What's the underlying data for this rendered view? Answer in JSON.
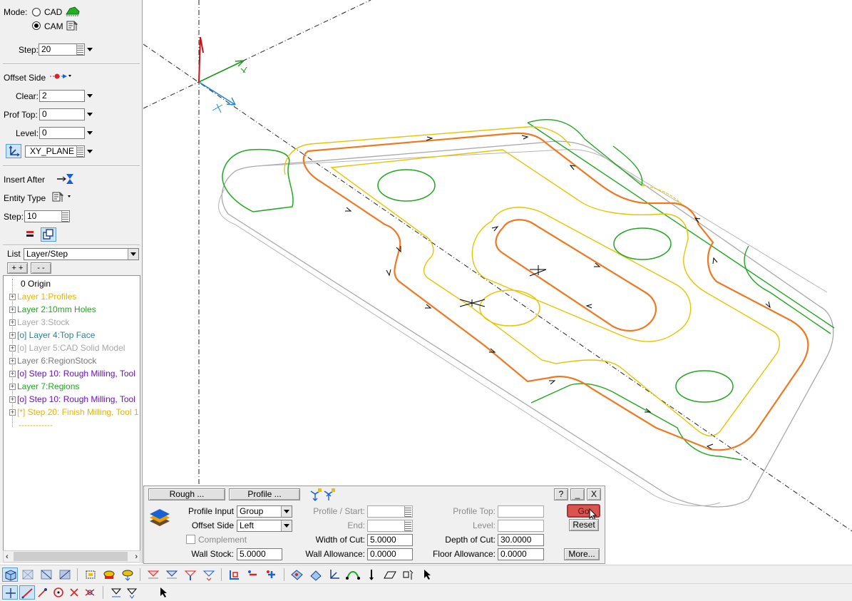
{
  "left_panel": {
    "mode_label": "Mode:",
    "mode_cad": "CAD",
    "mode_cam": "CAM",
    "step_label": "Step:",
    "step_value": "20",
    "offset_side_label": "Offset Side",
    "clear_label": "Clear:",
    "clear_value": "2",
    "prof_top_label": "Prof Top:",
    "prof_top_value": "0",
    "level_label": "Level:",
    "level_value": "0",
    "plane_value": "XY_PLANE",
    "insert_after_label": "Insert After",
    "entity_type_label": "Entity Type",
    "step2_label": "Step:",
    "step2_value": "10",
    "list_label": "List",
    "list_value": "Layer/Step",
    "expand_all": "+ +",
    "collapse_all": "- -"
  },
  "tree": {
    "items": [
      {
        "text": "0 Origin",
        "color": "#000000"
      },
      {
        "text": "Layer 1:Profiles",
        "color": "#e8b400"
      },
      {
        "text": "Layer 2:10mm Holes",
        "color": "#1fa81f"
      },
      {
        "text": "Layer 3:Stock",
        "color": "#a8a8a8"
      },
      {
        "text": "[o] Layer 4:Top Face",
        "color": "#2f7f8f"
      },
      {
        "text": "[o] Layer 5:CAD Solid Model",
        "color": "#a8a8a8"
      },
      {
        "text": "Layer 6:RegionStock",
        "color": "#7a7a7a"
      },
      {
        "text": "[o] Step 10: Rough Milling, Tool",
        "color": "#6a0dcc"
      },
      {
        "text": "Layer 7:Regions",
        "color": "#1fa81f"
      },
      {
        "text": "[o] Step 10: Rough Milling, Tool",
        "color": "#6a0dcc"
      },
      {
        "text": "[*] Step 20: Finish Milling, Tool 1",
        "color": "#e8b400"
      },
      {
        "text": "------------",
        "color": "#e8b400"
      }
    ]
  },
  "dialog": {
    "tab_rough": "Rough ...",
    "tab_profile": "Profile ...",
    "help_btn": "?",
    "min_btn": "_",
    "close_btn": "X",
    "profile_input_label": "Profile Input",
    "profile_input_value": "Group",
    "offset_side_label": "Offset Side",
    "offset_side_value": "Left",
    "complement_label": "Complement",
    "wall_stock_label": "Wall Stock:",
    "wall_stock_value": "5.0000",
    "profile_start_label": "Profile / Start:",
    "end_label": "End:",
    "width_of_cut_label": "Width of Cut:",
    "width_of_cut_value": "5.0000",
    "wall_allowance_label": "Wall Allowance:",
    "wall_allowance_value": "0.0000",
    "profile_top_label": "Profile Top:",
    "level_label": "Level:",
    "depth_of_cut_label": "Depth of Cut:",
    "depth_of_cut_value": "30.0000",
    "floor_allowance_label": "Floor Allowance:",
    "floor_allowance_value": "0.0000",
    "go_btn": "Go",
    "reset_btn": "Reset",
    "more_btn": "More..."
  },
  "colors": {
    "toolpath": "#f07820",
    "profile": "#e8c400",
    "hole": "#1fa81f",
    "stock": "#a8a8a8",
    "go_button": "#d9534f"
  }
}
